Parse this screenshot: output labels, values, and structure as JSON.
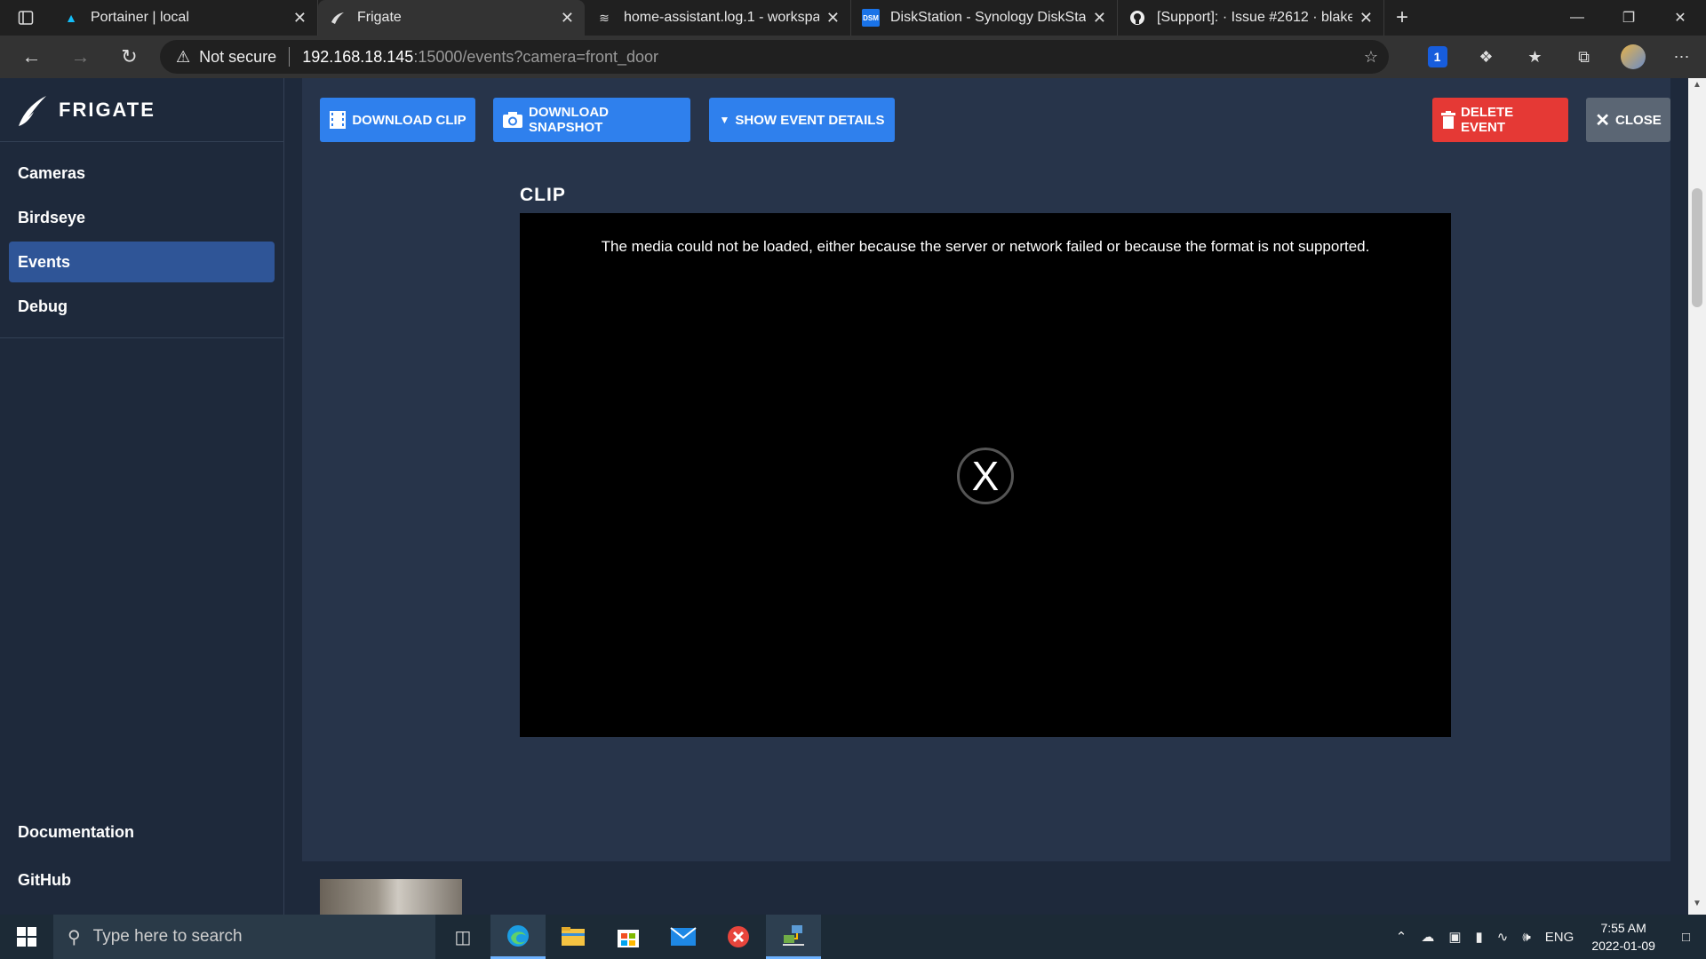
{
  "browser": {
    "tabs": [
      {
        "title": "Portainer | local",
        "active": false
      },
      {
        "title": "Frigate",
        "active": true
      },
      {
        "title": "home-assistant.log.1 - workspac",
        "active": false
      },
      {
        "title": "DiskStation - Synology DiskStatio",
        "active": false
      },
      {
        "title": "[Support]: · Issue #2612 · blakebl",
        "active": false
      }
    ],
    "security_label": "Not secure",
    "url_host": "192.168.18.145",
    "url_path": ":15000/events?camera=front_door",
    "bitwarden_badge": "1"
  },
  "sidebar": {
    "brand": "FRIGATE",
    "items": [
      {
        "label": "Cameras",
        "active": false
      },
      {
        "label": "Birdseye",
        "active": false
      },
      {
        "label": "Events",
        "active": true
      },
      {
        "label": "Debug",
        "active": false
      }
    ],
    "bottom_items": [
      {
        "label": "Documentation"
      },
      {
        "label": "GitHub"
      }
    ]
  },
  "toolbar": {
    "download_clip": "Download Clip",
    "download_snapshot": "Download Snapshot",
    "show_event_details": "Show Event Details",
    "delete_event": "Delete Event",
    "close": "Close"
  },
  "clip": {
    "title": "CLIP",
    "error_message": "The media could not be loaded, either because the server or network failed or because the format is not supported.",
    "error_symbol": "X"
  },
  "taskbar": {
    "search_placeholder": "Type here to search",
    "language": "ENG",
    "time": "7:55 AM",
    "date": "2022-01-09"
  }
}
